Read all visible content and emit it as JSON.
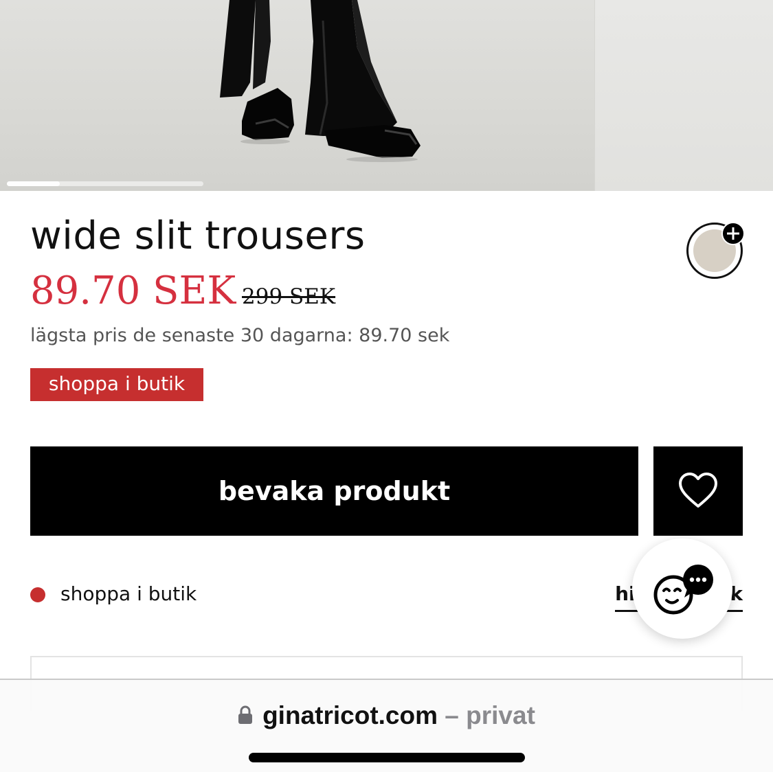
{
  "hero": {
    "image_count_indicator": 0.27
  },
  "product": {
    "title": "wide slit trousers",
    "sale_price": "89.70 SEK",
    "original_price": "299 SEK",
    "lowest_price_note": "lägsta pris de senaste 30 dagarna: 89.70 sek",
    "badge": "shoppa i butik",
    "swatch_color": "#d7d0c5"
  },
  "actions": {
    "watch_label": "bevaka produkt",
    "favorite_icon": "heart-icon"
  },
  "in_store": {
    "label": "shoppa i butik",
    "link_label": "hitta i butik",
    "dot_color": "#c62f2f"
  },
  "browser": {
    "domain": "ginatricot.com",
    "suffix": "– privat"
  },
  "colors": {
    "sale_price": "#d5303f",
    "badge_bg": "#c62f2f",
    "button_bg": "#000000"
  }
}
